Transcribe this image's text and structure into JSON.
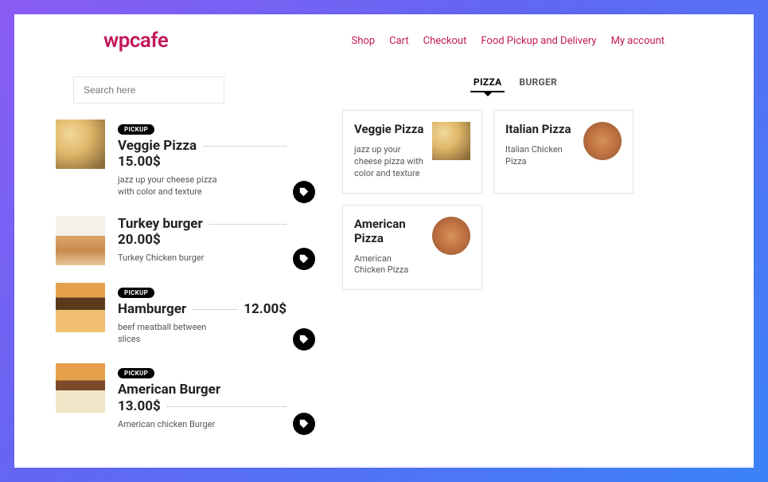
{
  "brand": "wpcafe",
  "nav": {
    "shop": "Shop",
    "cart": "Cart",
    "checkout": "Checkout",
    "pickup": "Food Pickup and Delivery",
    "account": "My account"
  },
  "search": {
    "placeholder": "Search here"
  },
  "badge": {
    "pickup": "PICKUP"
  },
  "menu": [
    {
      "title": "Veggie Pizza",
      "price": "15.00$",
      "desc": "jazz up your cheese pizza with color and texture"
    },
    {
      "title": "Turkey burger",
      "price": "20.00$",
      "desc": "Turkey Chicken burger"
    },
    {
      "title": "Hamburger",
      "price": "12.00$",
      "desc": "beef meatball between slices"
    },
    {
      "title": "American Burger",
      "price": "13.00$",
      "desc": "American chicken Burger"
    }
  ],
  "tabs": {
    "pizza": "PIZZA",
    "burger": "BURGER"
  },
  "cards": [
    {
      "title": "Veggie Pizza",
      "desc": "jazz up your cheese pizza with color and texture"
    },
    {
      "title": "Italian Pizza",
      "desc": "Italian Chicken Pizza"
    },
    {
      "title": "American Pizza",
      "desc": "American Chicken Pizza"
    }
  ]
}
